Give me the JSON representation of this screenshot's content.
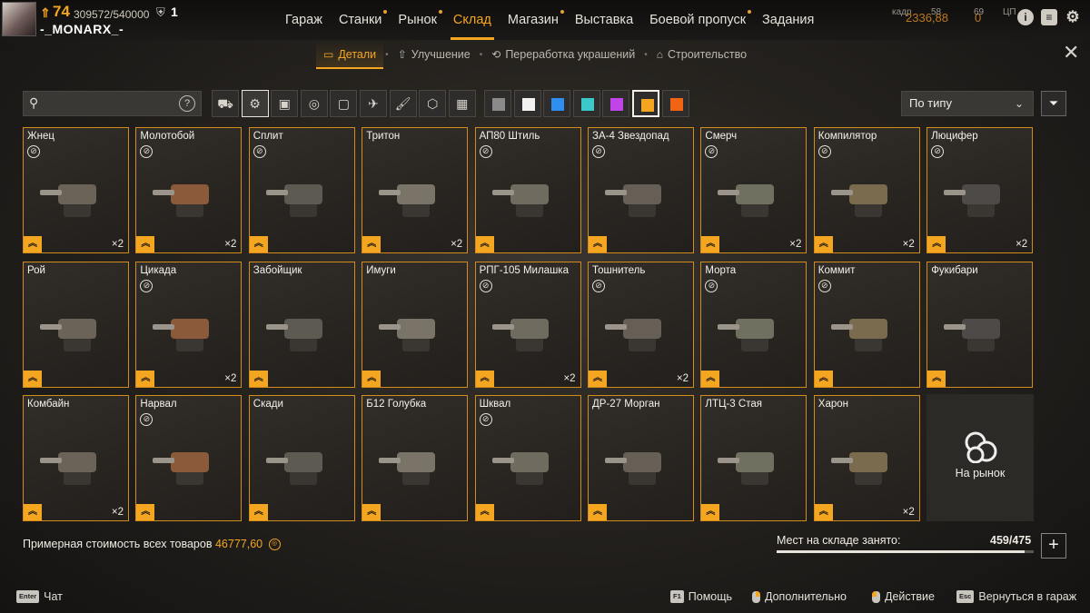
{
  "player": {
    "level": "74",
    "xp": "309572/540000",
    "prestige": "1",
    "nickname": "-_MONARX_-"
  },
  "nav": {
    "tabs": [
      {
        "label": "Гараж",
        "dot": false
      },
      {
        "label": "Станки",
        "dot": true
      },
      {
        "label": "Рынок",
        "dot": true
      },
      {
        "label": "Склад",
        "dot": false
      },
      {
        "label": "Магазин",
        "dot": true
      },
      {
        "label": "Выставка",
        "dot": false
      },
      {
        "label": "Боевой пропуск",
        "dot": true
      },
      {
        "label": "Задания",
        "dot": false
      }
    ],
    "active": "Склад"
  },
  "resources": {
    "clan_label": "кадр",
    "clan_value": "58",
    "coins_value": "2336,88",
    "badge_value": "0",
    "bp_label": "ЦП",
    "bp_value": "69"
  },
  "subtabs": [
    {
      "label": "Детали",
      "active": true
    },
    {
      "label": "Улучшение",
      "active": false
    },
    {
      "label": "Переработка украшений",
      "active": false
    },
    {
      "label": "Строительство",
      "active": false
    }
  ],
  "search": {
    "placeholder": ""
  },
  "filters": {
    "categories": [
      "cabin-icon",
      "weapon-icon",
      "module-icon",
      "wheel-icon",
      "frame-icon",
      "drone-icon",
      "paint-icon",
      "decor-icon",
      "grid-icon"
    ],
    "active_category": "weapon-icon",
    "rarity_colors": [
      "#8a8a8a",
      "#f2f2f2",
      "#2f8ff0",
      "#3cc8c8",
      "#c044e8",
      "#f4a620",
      "#f06414"
    ],
    "active_rarity": "#f4a620"
  },
  "sort": {
    "label": "По типу"
  },
  "items": [
    {
      "name": "Жнец",
      "count": "×2",
      "noparts": true
    },
    {
      "name": "Молотобой",
      "count": "×2",
      "noparts": true
    },
    {
      "name": "Сплит",
      "count": "",
      "noparts": true
    },
    {
      "name": "Тритон",
      "count": "×2",
      "noparts": false
    },
    {
      "name": "АП80 Штиль",
      "count": "",
      "noparts": true
    },
    {
      "name": "ЗА-4 Звездопад",
      "count": "",
      "noparts": true
    },
    {
      "name": "Смерч",
      "count": "×2",
      "noparts": true
    },
    {
      "name": "Компилятор",
      "count": "×2",
      "noparts": true
    },
    {
      "name": "Люцифер",
      "count": "×2",
      "noparts": true
    },
    {
      "name": "Рой",
      "count": "",
      "noparts": false
    },
    {
      "name": "Цикада",
      "count": "×2",
      "noparts": true
    },
    {
      "name": "Забойщик",
      "count": "",
      "noparts": false
    },
    {
      "name": "Имуги",
      "count": "",
      "noparts": false
    },
    {
      "name": "РПГ-105 Милашка",
      "count": "×2",
      "noparts": true
    },
    {
      "name": "Тошнитель",
      "count": "×2",
      "noparts": true
    },
    {
      "name": "Морта",
      "count": "",
      "noparts": true
    },
    {
      "name": "Коммит",
      "count": "",
      "noparts": true
    },
    {
      "name": "Фукибари",
      "count": "",
      "noparts": false
    },
    {
      "name": "Комбайн",
      "count": "×2",
      "noparts": false
    },
    {
      "name": "Нарвал",
      "count": "",
      "noparts": true
    },
    {
      "name": "Скади",
      "count": "",
      "noparts": false
    },
    {
      "name": "Б12 Голубка",
      "count": "",
      "noparts": false
    },
    {
      "name": "Шквал",
      "count": "",
      "noparts": true
    },
    {
      "name": "ДР-27 Морган",
      "count": "",
      "noparts": false
    },
    {
      "name": "ЛТЦ-3 Стая",
      "count": "",
      "noparts": false
    },
    {
      "name": "Харон",
      "count": "×2",
      "noparts": false
    }
  ],
  "market_tile": {
    "label": "На рынок"
  },
  "footer": {
    "total_label": "Примерная стоимость всех товаров",
    "total_value": "46777,60",
    "storage_label": "Мест на складе занято:",
    "storage_value": "459/475",
    "storage_fraction": 0.966
  },
  "hints": {
    "chat_key": "Enter",
    "chat": "Чат",
    "help_key": "F1",
    "help": "Помощь",
    "more": "Дополнительно",
    "action": "Действие",
    "back_key": "Esc",
    "back": "Вернуться в гараж"
  }
}
